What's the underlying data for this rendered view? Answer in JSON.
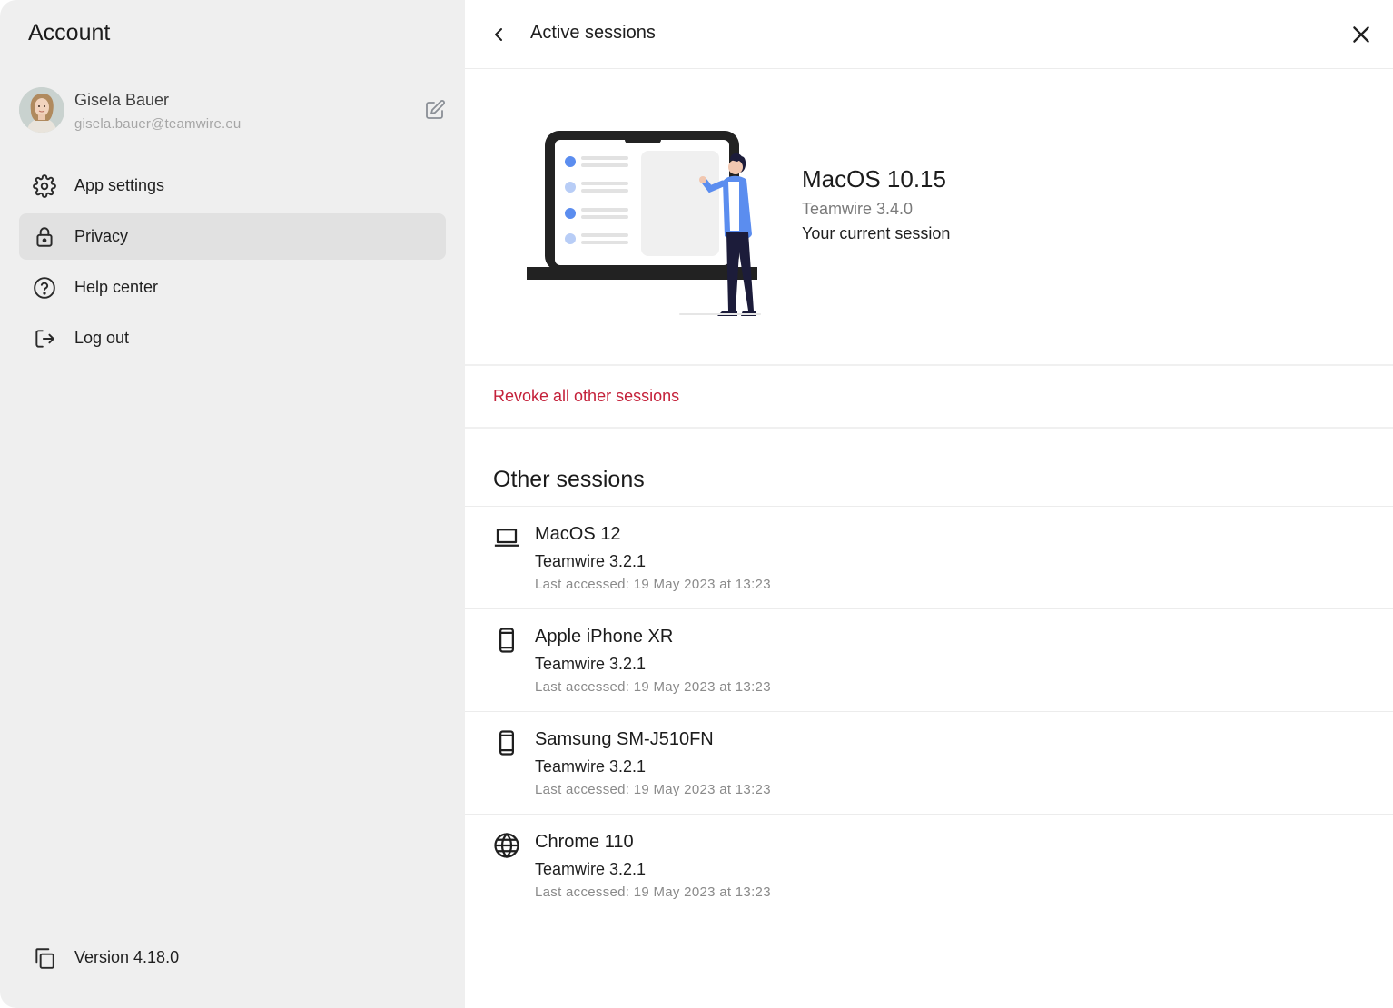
{
  "sidebar": {
    "title": "Account",
    "profile": {
      "name": "Gisela Bauer",
      "email": "gisela.bauer@teamwire.eu"
    },
    "items": [
      {
        "label": "App settings",
        "icon": "gear-icon",
        "active": false
      },
      {
        "label": "Privacy",
        "icon": "lock-icon",
        "active": true
      },
      {
        "label": "Help center",
        "icon": "question-circle-icon",
        "active": false
      },
      {
        "label": "Log out",
        "icon": "logout-icon",
        "active": false
      }
    ],
    "version": "Version 4.18.0"
  },
  "header": {
    "title": "Active sessions"
  },
  "current_session": {
    "device": "MacOS 10.15",
    "app": "Teamwire 3.4.0",
    "note": "Your current session"
  },
  "revoke_label": "Revoke all other sessions",
  "other_sessions": {
    "title": "Other sessions",
    "items": [
      {
        "device": "MacOS 12",
        "app": "Teamwire 3.2.1",
        "last_accessed": "Last accessed: 19 May 2023 at 13:23",
        "icon": "laptop-icon"
      },
      {
        "device": "Apple iPhone XR",
        "app": "Teamwire 3.2.1",
        "last_accessed": "Last accessed: 19 May 2023 at 13:23",
        "icon": "phone-icon"
      },
      {
        "device": "Samsung SM-J510FN",
        "app": "Teamwire 3.2.1",
        "last_accessed": "Last accessed: 19 May 2023 at 13:23",
        "icon": "phone-icon"
      },
      {
        "device": "Chrome 110",
        "app": "Teamwire 3.2.1",
        "last_accessed": "Last accessed: 19 May 2023 at 13:23",
        "icon": "globe-icon"
      }
    ]
  },
  "colors": {
    "sidebar_bg": "#efefef",
    "active_item_bg": "#e1e1e1",
    "danger": "#c4213a",
    "accent_blue": "#5b8def"
  }
}
